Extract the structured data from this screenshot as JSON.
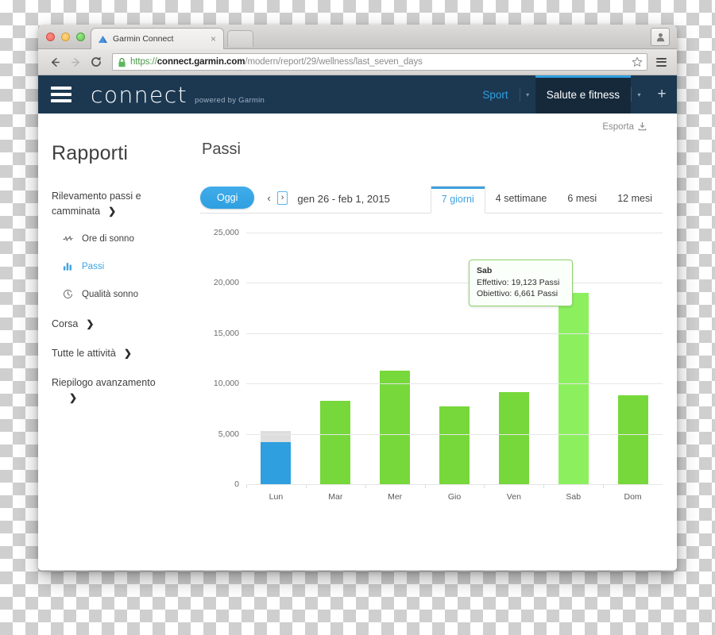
{
  "browser": {
    "tab": {
      "title": "Garmin Connect",
      "close_label": "×",
      "favicon": "garmin-triangle-icon"
    },
    "new_tab_label": "",
    "nav": {
      "back": "←",
      "forward": "→",
      "reload": "⟳"
    },
    "url": {
      "scheme": "https://",
      "host": "connect.garmin.com",
      "path": "/modern/report/29/wellness/last_seven_days",
      "full": "https://connect.garmin.com/modern/report/29/wellness/last_seven_days"
    },
    "bookmark_icon": "star-icon",
    "menu_icon": "hamburger-menu-icon",
    "profile_icon": "user-avatar-icon"
  },
  "header": {
    "menu_icon": "hamburger-menu-icon",
    "brand": "connect",
    "brand_sub": "powered by Garmin",
    "nav": [
      {
        "label": "Sport",
        "active": false,
        "caret": "▾"
      },
      {
        "label": "Salute e fitness",
        "active": true,
        "caret": "▾"
      }
    ],
    "add_label": "+"
  },
  "export": {
    "label": "Esporta",
    "icon": "export-download-icon"
  },
  "sidebar": {
    "page_title": "Rapporti",
    "groups": [
      {
        "label": "Rilevamento passi e camminata",
        "chevron": "❯"
      }
    ],
    "sub_items": [
      {
        "label": "Ore di sonno",
        "icon": "pulse-waveform-icon",
        "active": false
      },
      {
        "label": "Passi",
        "icon": "bar-chart-icon",
        "active": true
      },
      {
        "label": "Qualità sonno",
        "icon": "clock-icon",
        "active": false
      }
    ],
    "groups_after": [
      {
        "label": "Corsa",
        "chevron": "❯"
      },
      {
        "label": "Tutte le attività",
        "chevron": "❯"
      },
      {
        "label": "Riepilogo avanzamento",
        "chevron": "❯"
      }
    ]
  },
  "main": {
    "title": "Passi",
    "today_button": "Oggi",
    "prev_arrow": "‹",
    "next_arrow": "›",
    "date_range": "gen 26 - feb 1, 2015",
    "range_tabs": [
      {
        "label": "7 giorni",
        "active": true
      },
      {
        "label": "4 settimane",
        "active": false
      },
      {
        "label": "6 mesi",
        "active": false
      },
      {
        "label": "12 mesi",
        "active": false
      }
    ]
  },
  "tooltip": {
    "day": "Sab",
    "actual_line": "Effettivo: 19,123 Passi",
    "goal_line": "Obiettivo: 6,661 Passi"
  },
  "colors": {
    "brand_dark": "#1c3851",
    "accent_blue": "#2f9fe0",
    "bar_green": "#76d83a",
    "bar_green_hover": "#8cf05e",
    "bar_blue": "#2f9fe0",
    "bar_goal_grey": "#dedede",
    "tooltip_border": "#8fd36a"
  },
  "chart_data": {
    "type": "bar",
    "title": "Passi",
    "xlabel": "",
    "ylabel": "",
    "categories": [
      "Lun",
      "Mar",
      "Mer",
      "Gio",
      "Ven",
      "Sab",
      "Dom"
    ],
    "series": [
      {
        "name": "Effettivo",
        "values": [
          4250,
          8400,
          11350,
          7800,
          9200,
          19123,
          8950
        ]
      },
      {
        "name": "Obiettivo",
        "values": [
          5300,
          null,
          null,
          null,
          null,
          6661,
          null
        ]
      }
    ],
    "bar_colors": [
      "#2f9fe0",
      "#76d83a",
      "#76d83a",
      "#76d83a",
      "#76d83a",
      "#8cf05e",
      "#76d83a"
    ],
    "goal_overlay_color": "#dedede",
    "yticks": [
      0,
      5000,
      10000,
      15000,
      20000,
      25000
    ],
    "ytick_labels": [
      "0",
      "5,000",
      "10,000",
      "15,000",
      "20,000",
      "25,000"
    ],
    "ylim": [
      0,
      25000
    ],
    "grid": true,
    "legend": false,
    "annotations": [
      {
        "day": "Sab",
        "actual": 19123,
        "goal": 6661,
        "unit": "Passi"
      }
    ]
  }
}
